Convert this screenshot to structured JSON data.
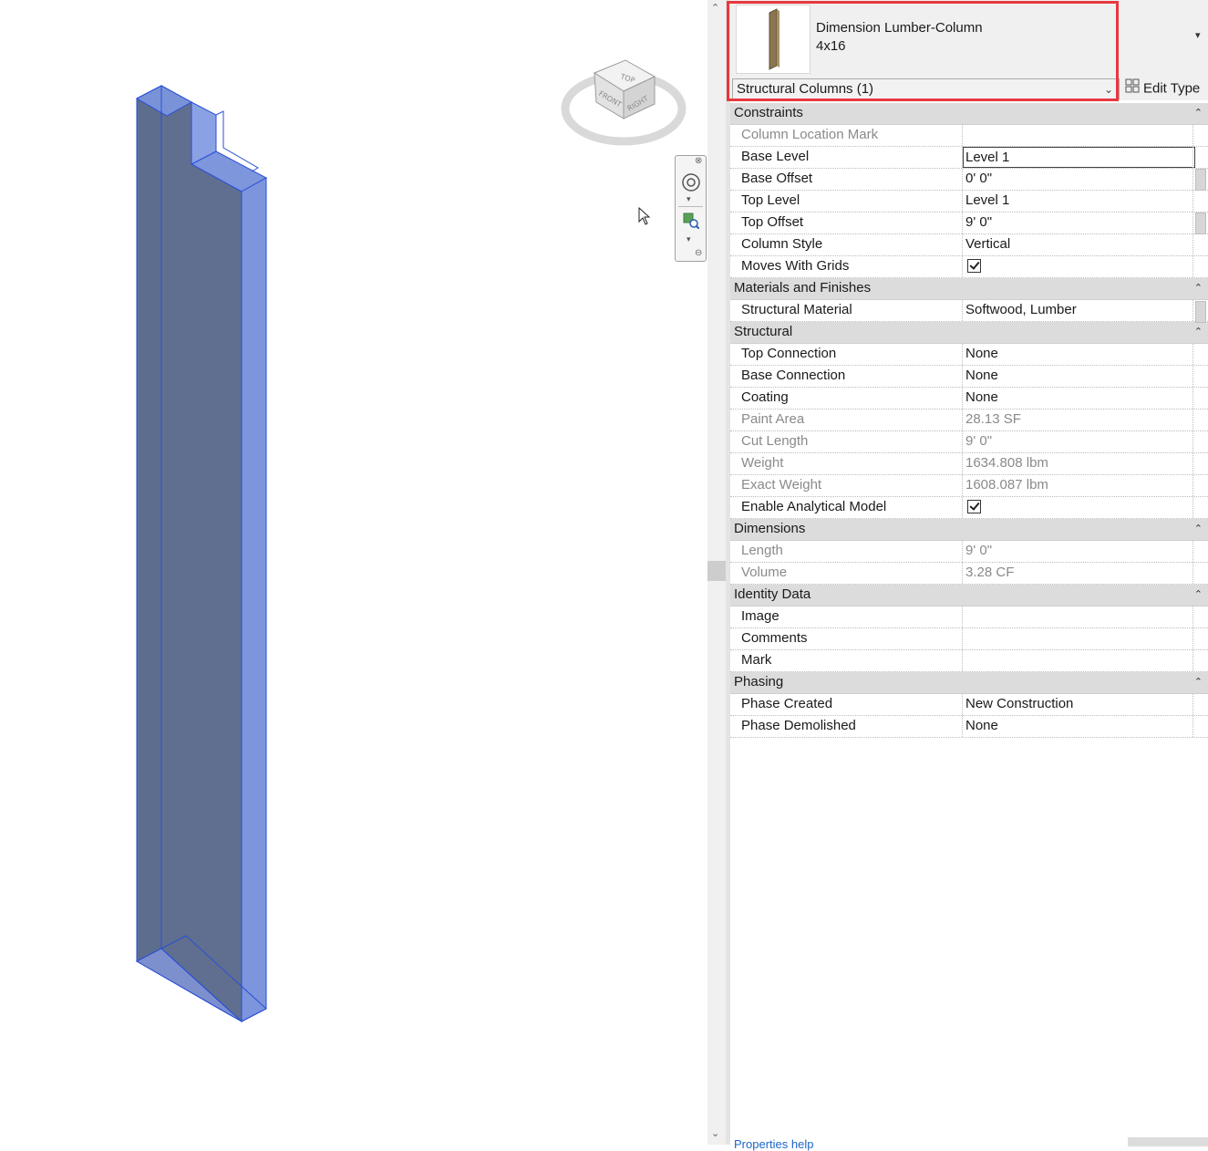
{
  "type_selector": {
    "family": "Dimension Lumber-Column",
    "type": "4x16"
  },
  "filter": {
    "selected": "Structural Columns (1)",
    "edit_type_label": "Edit Type"
  },
  "viewcube": {
    "top": "TOP",
    "front": "FRONT",
    "right": "RIGHT"
  },
  "categories": [
    {
      "name": "Constraints",
      "rows": [
        {
          "label": "Column Location Mark",
          "value": "",
          "readonly": true
        },
        {
          "label": "Base Level",
          "value": "Level 1",
          "editing": true
        },
        {
          "label": "Base Offset",
          "value": "0'  0\""
        },
        {
          "label": "Top Level",
          "value": "Level 1"
        },
        {
          "label": "Top Offset",
          "value": "9'  0\""
        },
        {
          "label": "Column Style",
          "value": "Vertical"
        },
        {
          "label": "Moves With Grids",
          "value": "",
          "checkbox": true,
          "checked": true
        }
      ]
    },
    {
      "name": "Materials and Finishes",
      "rows": [
        {
          "label": "Structural Material",
          "value": "Softwood, Lumber"
        }
      ]
    },
    {
      "name": "Structural",
      "rows": [
        {
          "label": "Top Connection",
          "value": "None"
        },
        {
          "label": "Base Connection",
          "value": "None"
        },
        {
          "label": "Coating",
          "value": "None"
        },
        {
          "label": "Paint Area",
          "value": "28.13 SF",
          "readonly": true
        },
        {
          "label": "Cut Length",
          "value": "9'  0\"",
          "readonly": true
        },
        {
          "label": "Weight",
          "value": "1634.808 lbm",
          "readonly": true
        },
        {
          "label": "Exact Weight",
          "value": "1608.087 lbm",
          "readonly": true
        },
        {
          "label": "Enable Analytical Model",
          "value": "",
          "checkbox": true,
          "checked": true
        }
      ]
    },
    {
      "name": "Dimensions",
      "rows": [
        {
          "label": "Length",
          "value": "9'  0\"",
          "readonly": true
        },
        {
          "label": "Volume",
          "value": "3.28 CF",
          "readonly": true
        }
      ]
    },
    {
      "name": "Identity Data",
      "rows": [
        {
          "label": "Image",
          "value": ""
        },
        {
          "label": "Comments",
          "value": ""
        },
        {
          "label": "Mark",
          "value": ""
        }
      ]
    },
    {
      "name": "Phasing",
      "rows": [
        {
          "label": "Phase Created",
          "value": "New Construction"
        },
        {
          "label": "Phase Demolished",
          "value": "None"
        }
      ]
    }
  ],
  "colors": {
    "selection_fill": "#5a6b8c",
    "selection_edge": "#2a4fd6",
    "highlight_box": "#e8383f",
    "category_bg": "#dcdcdc"
  }
}
